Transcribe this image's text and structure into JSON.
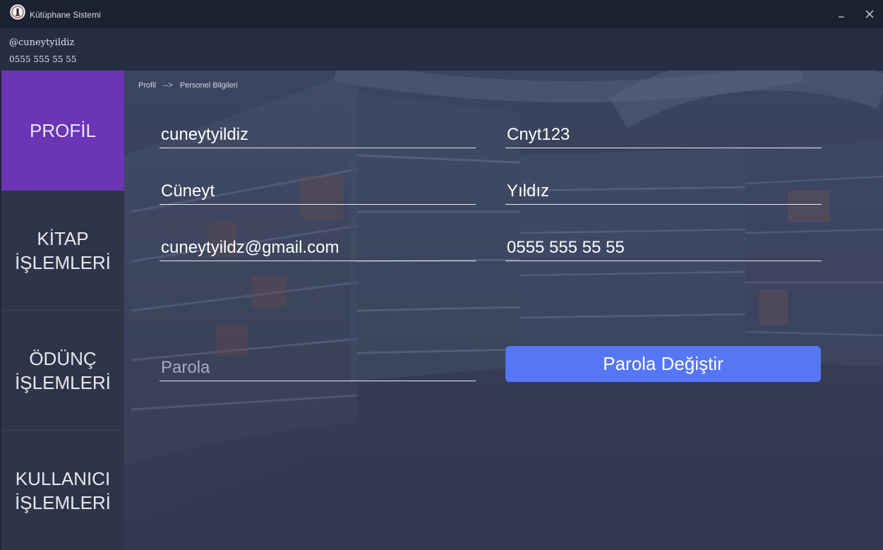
{
  "window": {
    "title": "Kütüphane Sistemi"
  },
  "user": {
    "handle": "@cuneytyildiz",
    "phone": "0555 555 55 55"
  },
  "sidebar": {
    "items": [
      {
        "label": "PROFİL",
        "active": true
      },
      {
        "label": "KİTAP\nİŞLEMLERİ",
        "active": false
      },
      {
        "label": "ÖDÜNÇ\nİŞLEMLERİ",
        "active": false
      },
      {
        "label": "KULLANICI\nİŞLEMLERİ",
        "active": false
      }
    ]
  },
  "breadcrumb": {
    "items": [
      "Profil",
      "Personel Bilgileri"
    ],
    "separator": "-->"
  },
  "form": {
    "username": "cuneytyildiz",
    "password_display": "Cnyt123",
    "first_name": "Cüneyt",
    "last_name": "Yıldız",
    "email": "cuneytyildz@gmail.com",
    "phone": "0555 555 55 55",
    "password_placeholder": "Parola",
    "change_password_label": "Parola Değiştir"
  },
  "colors": {
    "accent": "#5577f5",
    "active_nav": "#6b35b6",
    "titlebar": "#1b2130"
  }
}
